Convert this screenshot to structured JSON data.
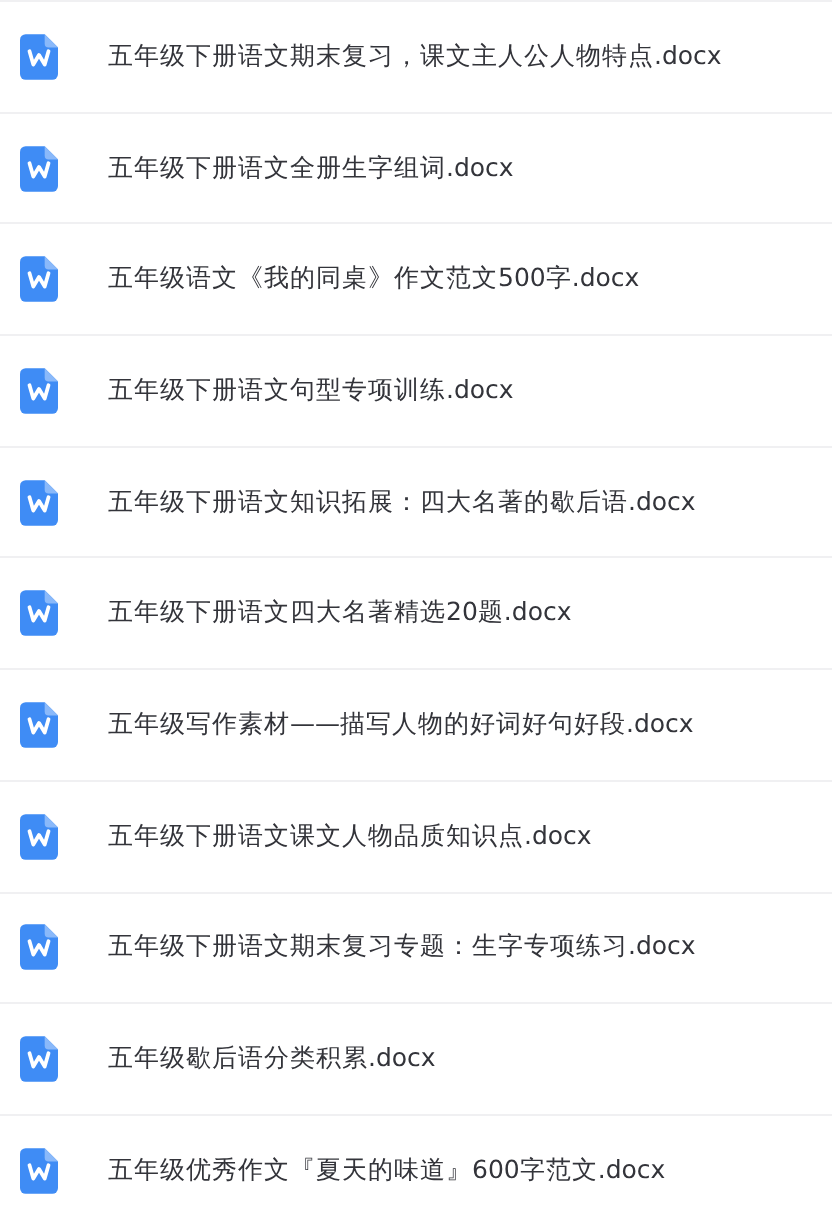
{
  "files": [
    {
      "name": "五年级下册语文期末复习，课文主人公人物特点.docx",
      "kind": "word"
    },
    {
      "name": "五年级下册语文全册生字组词.docx",
      "kind": "word"
    },
    {
      "name": "五年级语文《我的同桌》作文范文500字.docx",
      "kind": "word"
    },
    {
      "name": "五年级下册语文句型专项训练.docx",
      "kind": "word"
    },
    {
      "name": "五年级下册语文知识拓展：四大名著的歇后语.docx",
      "kind": "word"
    },
    {
      "name": "五年级下册语文四大名著精选20题.docx",
      "kind": "word"
    },
    {
      "name": "五年级写作素材——描写人物的好词好句好段.docx",
      "kind": "word"
    },
    {
      "name": "五年级下册语文课文人物品质知识点.docx",
      "kind": "word"
    },
    {
      "name": "五年级下册语文期末复习专题：生字专项练习.docx",
      "kind": "word"
    },
    {
      "name": "五年级歇后语分类积累.docx",
      "kind": "word"
    },
    {
      "name": "五年级优秀作文『夏天的味道』600字范文.docx",
      "kind": "word"
    }
  ]
}
